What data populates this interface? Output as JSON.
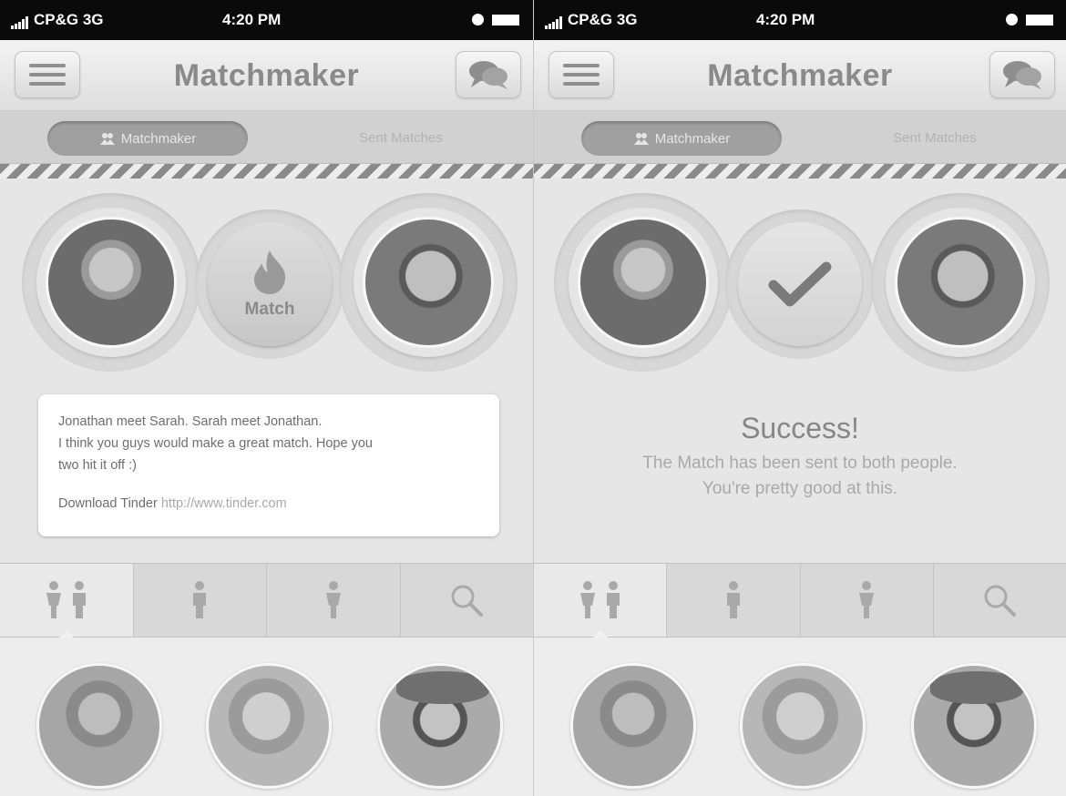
{
  "status_bar": {
    "carrier": "CP&G 3G",
    "time": "4:20 PM"
  },
  "nav": {
    "title": "Matchmaker",
    "menu_icon": "hamburger-menu-icon",
    "chat_icon": "chat-bubbles-icon"
  },
  "segments": {
    "active": "Matchmaker",
    "inactive": "Sent Matches"
  },
  "left_screen": {
    "match_button_label": "Match",
    "message": {
      "line1": "Jonathan meet Sarah. Sarah meet Jonathan.",
      "line2": "I think you guys would make a great match. Hope you",
      "line3": "two hit it off :)",
      "download_label": "Download Tinder",
      "download_link": "http://www.tinder.com"
    }
  },
  "right_screen": {
    "success_title": "Success!",
    "success_line1": "The Match has been sent to both people.",
    "success_line2": "You're pretty good at this."
  },
  "filter_tabs": [
    {
      "icon": "couple-icon",
      "active": true
    },
    {
      "icon": "man-icon",
      "active": false
    },
    {
      "icon": "woman-icon",
      "active": false
    },
    {
      "icon": "search-icon",
      "active": false
    }
  ],
  "colors": {
    "status_bar": "#0a0a0a",
    "title": "#8a8a8a",
    "stripe_dark": "#8a8a8a",
    "card": "#ffffff"
  }
}
